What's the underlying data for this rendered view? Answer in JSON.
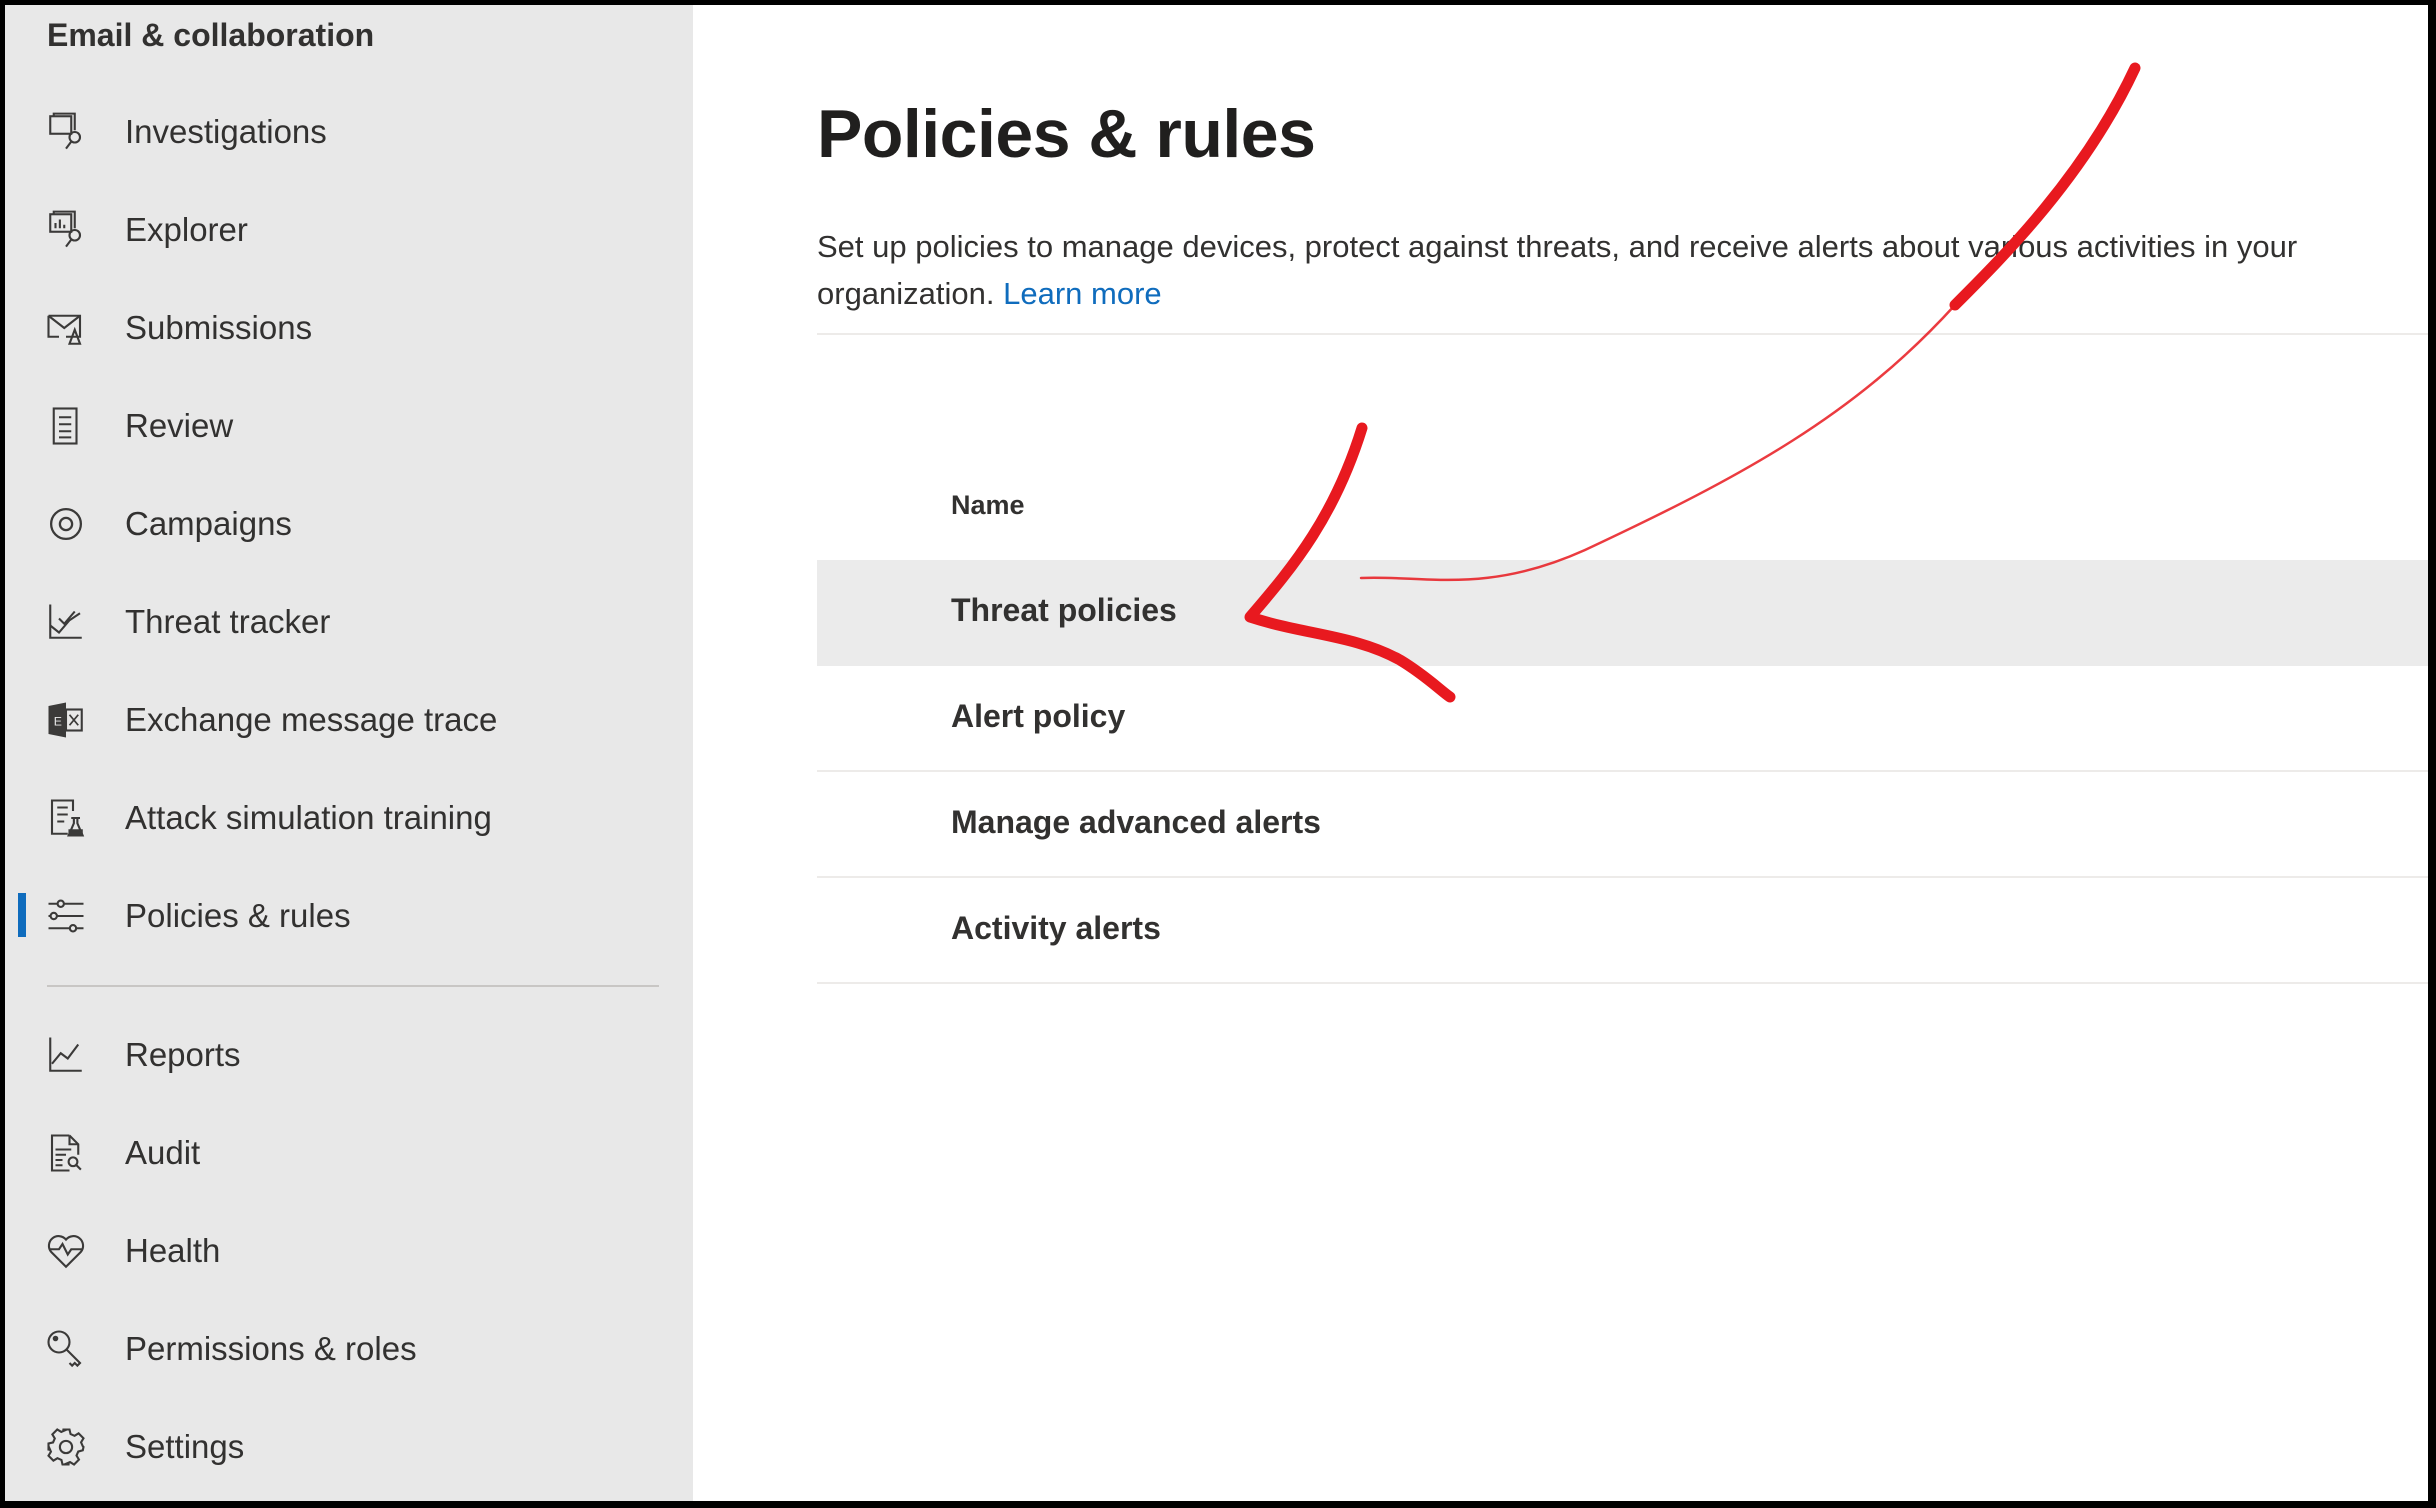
{
  "sidebar": {
    "section_title": "Email & collaboration",
    "items": [
      {
        "label": "Investigations",
        "icon": "investigations-icon"
      },
      {
        "label": "Explorer",
        "icon": "explorer-icon"
      },
      {
        "label": "Submissions",
        "icon": "submissions-icon"
      },
      {
        "label": "Review",
        "icon": "review-icon"
      },
      {
        "label": "Campaigns",
        "icon": "campaigns-icon"
      },
      {
        "label": "Threat tracker",
        "icon": "threat-tracker-icon"
      },
      {
        "label": "Exchange message trace",
        "icon": "exchange-icon"
      },
      {
        "label": "Attack simulation training",
        "icon": "attack-simulation-icon"
      },
      {
        "label": "Policies & rules",
        "icon": "sliders-icon",
        "active": true
      }
    ],
    "footer_items": [
      {
        "label": "Reports",
        "icon": "reports-chart-icon"
      },
      {
        "label": "Audit",
        "icon": "audit-icon"
      },
      {
        "label": "Health",
        "icon": "health-heart-icon"
      },
      {
        "label": "Permissions & roles",
        "icon": "key-icon"
      },
      {
        "label": "Settings",
        "icon": "gear-icon"
      }
    ],
    "active_color": "#0f6cbd"
  },
  "main": {
    "title": "Policies & rules",
    "description": "Set up policies to manage devices, protect against threats, and receive alerts about various activities in your organization.",
    "learn_more": "Learn more",
    "table": {
      "column_header": "Name",
      "rows": [
        {
          "name": "Threat policies",
          "selected": true
        },
        {
          "name": "Alert policy"
        },
        {
          "name": "Manage advanced alerts"
        },
        {
          "name": "Activity alerts"
        }
      ]
    }
  },
  "annotation": {
    "type": "hand-drawn arrow",
    "color": "#e8191f",
    "points_to": "Threat policies"
  }
}
